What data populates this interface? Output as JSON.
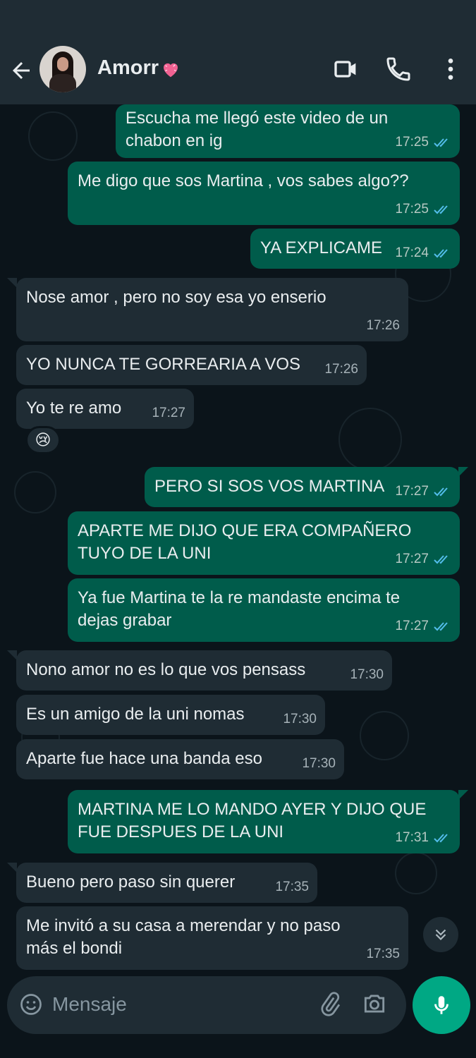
{
  "header": {
    "contact_name": "Amorr",
    "heart_emoji": "💗",
    "icons": [
      "back-arrow-icon",
      "video-call-icon",
      "voice-call-icon",
      "more-vert-icon"
    ]
  },
  "messages": [
    {
      "dir": "out",
      "text": "Escucha me llegó este video de un\nchabon en ig",
      "time": "17:25"
    },
    {
      "dir": "out",
      "text": "Me digo que sos Martina , vos sabes algo??",
      "time": "17:25"
    },
    {
      "dir": "out",
      "text": "YA EXPLICAME",
      "time": "17:24"
    },
    {
      "dir": "in",
      "text": "Nose amor , pero no soy esa yo enserio",
      "time": "17:26"
    },
    {
      "dir": "in",
      "text": "YO NUNCA TE GORREARIA A VOS",
      "time": "17:26"
    },
    {
      "dir": "in",
      "text": "Yo te re amo",
      "time": "17:27",
      "reaction": "😢"
    },
    {
      "dir": "out",
      "text": "PERO SI SOS VOS MARTINA",
      "time": "17:27"
    },
    {
      "dir": "out",
      "text": "APARTE ME DIJO QUE ERA COMPAÑERO\nTUYO DE LA UNI",
      "time": "17:27"
    },
    {
      "dir": "out",
      "text": "Ya fue Martina te la re mandaste encima te\ndejas grabar",
      "time": "17:27"
    },
    {
      "dir": "in",
      "text": "Nono amor no es lo que vos pensass",
      "time": "17:30"
    },
    {
      "dir": "in",
      "text": "Es un amigo de la uni nomas",
      "time": "17:30"
    },
    {
      "dir": "in",
      "text": "Aparte fue hace una banda eso",
      "time": "17:30"
    },
    {
      "dir": "out",
      "text": "MARTINA ME LO MANDO AYER Y DIJO QUE\nFUE DESPUES DE LA UNI",
      "time": "17:31"
    },
    {
      "dir": "in",
      "text": "Bueno pero paso sin querer",
      "time": "17:35"
    },
    {
      "dir": "in",
      "text": "Me invitó a su casa a merendar y no paso\nmás el bondi",
      "time": "17:35"
    }
  ],
  "input": {
    "placeholder": "Mensaje"
  },
  "colors": {
    "outgoing_bubble": "#005c4b",
    "incoming_bubble": "#1f2c34",
    "background": "#0b141a",
    "read_ticks": "#53bdeb",
    "accent": "#00a884"
  }
}
